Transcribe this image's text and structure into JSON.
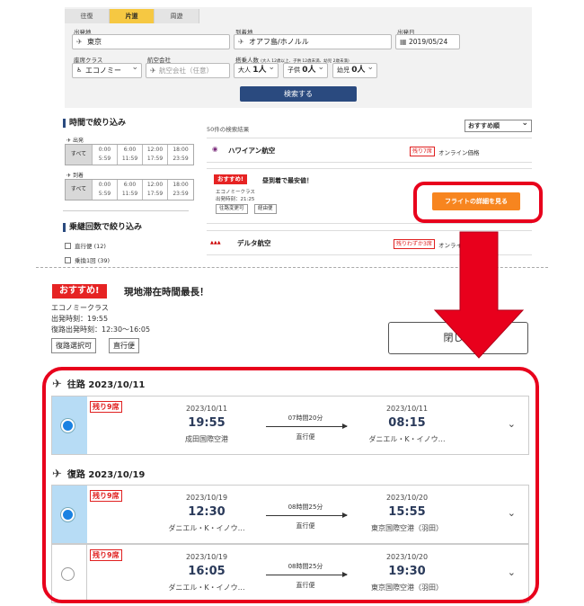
{
  "search_form": {
    "tabs": [
      "往復",
      "片道",
      "周遊"
    ],
    "active_tab": "片道",
    "origin_label": "出発地",
    "origin_value": "東京",
    "destination_label": "到着地",
    "destination_value": "オアフ島/ホノルル",
    "date_label": "出発日",
    "date_value": "2019/05/24",
    "class_label": "座席クラス",
    "class_value": "エコノミー",
    "airline_label": "航空会社",
    "airline_placeholder": "航空会社（任意）",
    "pax_label": "搭乗人数",
    "pax_note": "(大人 12歳以上、子供 12歳未満、幼児 2歳未満)",
    "pax_adult_label": "大人",
    "pax_adult_value": "1人",
    "pax_child_label": "子供",
    "pax_child_value": "0人",
    "pax_infant_label": "幼児",
    "pax_infant_value": "0人",
    "search_button": "検索する"
  },
  "sidebar": {
    "time_filter_title": "時間で絞り込み",
    "depart_label": "出発",
    "arrive_label": "到着",
    "slots": [
      {
        "a": "すべて"
      },
      {
        "a": "0:00",
        "b": "5:59"
      },
      {
        "a": "6:00",
        "b": "11:59"
      },
      {
        "a": "12:00",
        "b": "17:59"
      },
      {
        "a": "18:00",
        "b": "23:59"
      }
    ],
    "stops_filter_title": "乗継回数で絞り込み",
    "stop_options": [
      "直行便 (12)",
      "乗換1回 (39)"
    ]
  },
  "results": {
    "count_text": "50件の検索結果",
    "sort_value": "おすすめ順",
    "card1": {
      "airline": "ハワイアン航空",
      "seats": "残り7席",
      "price": "オンライン価格"
    },
    "card2": {
      "badge": "おすすめ!",
      "headline": "昼到着で最安値！",
      "class": "エコノミークラス",
      "depart": "出発時刻：21:25",
      "chip1": "往路変更可",
      "chip2": "経由便",
      "detail_button": "フライトの詳細を見る"
    },
    "card3": {
      "airline": "デルタ航空",
      "seats": "残りわずか3席",
      "price": "オンライン価格"
    }
  },
  "detail": {
    "badge": "おすすめ!",
    "headline": "現地滞在時間最長！",
    "class": "エコノミークラス",
    "depart_time": "出発時刻：19:55",
    "return_time": "復路出発時刻：12:30～16:05",
    "chip1": "復路選択可",
    "chip2": "直行便",
    "close_button": "閉じる",
    "outbound_title": "往路 2023/10/11",
    "return_title": "復路 2023/10/19",
    "rows": [
      {
        "seats": "残り9席",
        "dep_date": "2023/10/11",
        "dep_time": "19:55",
        "dep_airport": "成田国際空港",
        "duration": "07時間20分",
        "type": "直行便",
        "arr_date": "2023/10/11",
        "arr_time": "08:15",
        "arr_airport": "ダニエル・K・イノウ…"
      },
      {
        "seats": "残り9席",
        "dep_date": "2023/10/19",
        "dep_time": "12:30",
        "dep_airport": "ダニエル・K・イノウ…",
        "duration": "08時間25分",
        "type": "直行便",
        "arr_date": "2023/10/20",
        "arr_time": "15:55",
        "arr_airport": "東京国際空港（羽田）"
      },
      {
        "seats": "残り9席",
        "dep_date": "2023/10/19",
        "dep_time": "16:05",
        "dep_airport": "ダニエル・K・イノウ…",
        "duration": "08時間25分",
        "type": "直行便",
        "arr_date": "2023/10/20",
        "arr_time": "19:30",
        "arr_airport": "東京国際空港（羽田）"
      }
    ]
  },
  "colors": {
    "accent_red": "#e8001c",
    "orange_button": "#f7851f",
    "navy": "#2a4a7f",
    "tab_yellow": "#f6c842",
    "selected_blue": "#b7dcf5"
  }
}
